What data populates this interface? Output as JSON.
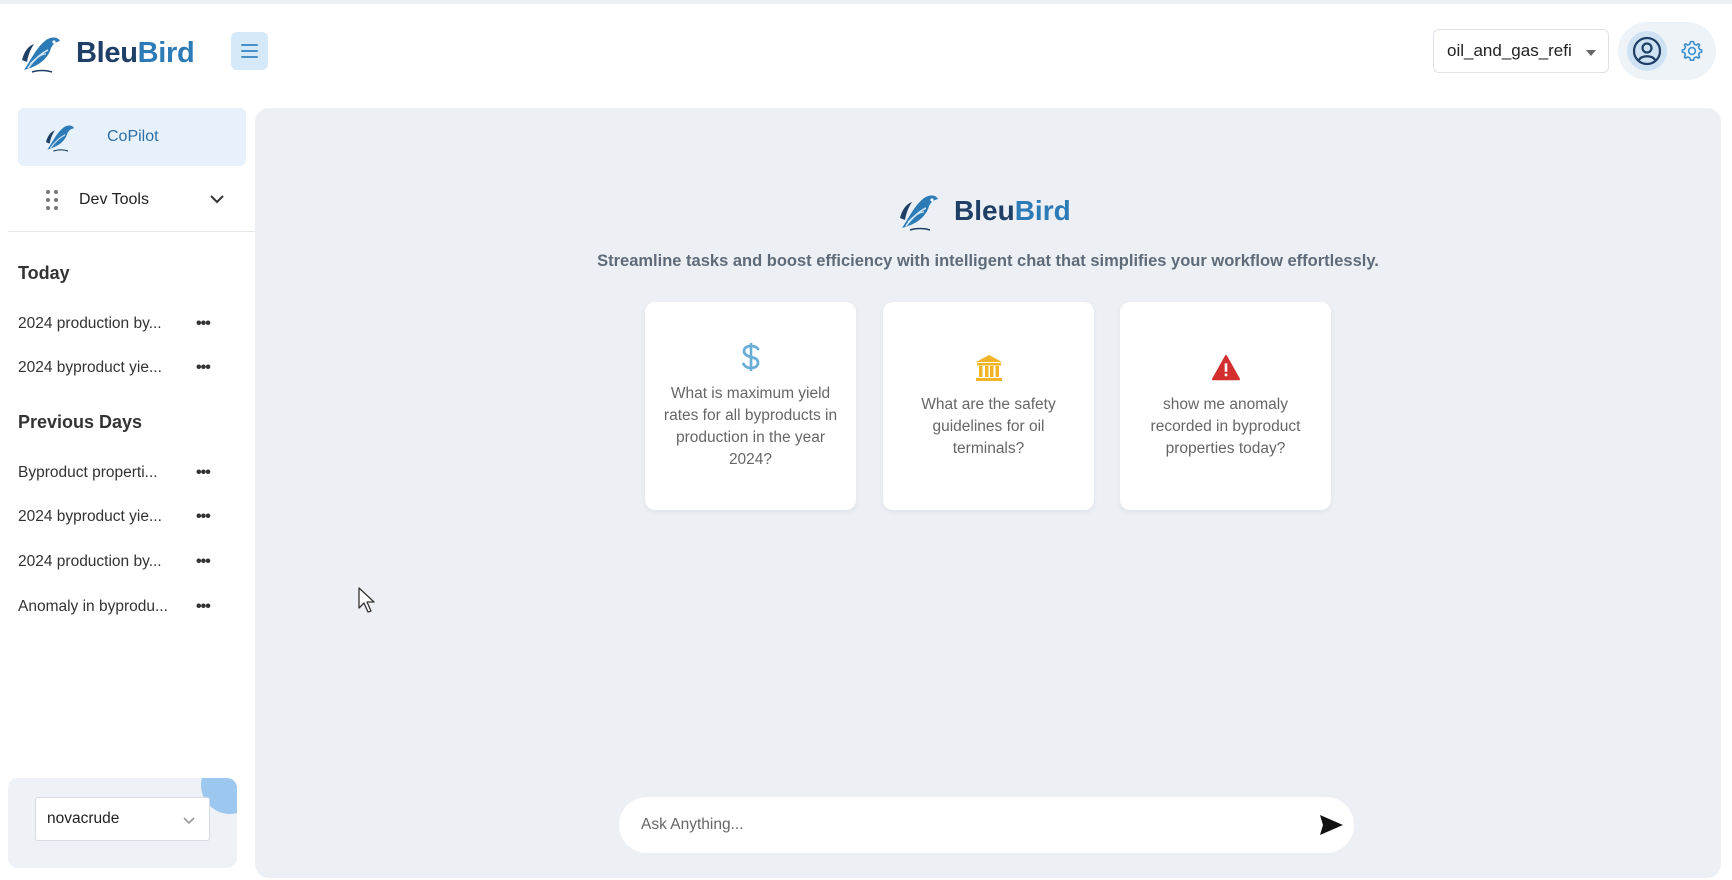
{
  "header": {
    "brand_part1": "Bleu",
    "brand_part2": "Bird",
    "database_select": {
      "value": "oil_and_gas_refi"
    }
  },
  "sidebar": {
    "copilot_label": "CoPilot",
    "devtools_label": "Dev Tools",
    "today_title": "Today",
    "today_items": [
      "2024 production by...",
      "2024 byproduct yie..."
    ],
    "previous_title": "Previous Days",
    "previous_items": [
      "Byproduct properti...",
      "2024 byproduct yie...",
      "2024 production by...",
      "Anomaly in byprodu..."
    ],
    "more_glyph": "•••",
    "tenant_select": {
      "value": "novacrude"
    }
  },
  "main": {
    "brand_part1": "Bleu",
    "brand_part2": "Bird",
    "tagline": "Streamline tasks and boost efficiency with intelligent chat that simplifies your workflow effortlessly.",
    "cards": [
      {
        "icon": "dollar-icon",
        "text": "What is maximum yield rates for all byproducts in production in the year 2024?"
      },
      {
        "icon": "bank-icon",
        "text": "What are the safety guidelines for oil terminals?"
      },
      {
        "icon": "warning-icon",
        "text": "show me anomaly recorded in byproduct properties today?"
      }
    ],
    "ask_placeholder": "Ask Anything..."
  },
  "colors": {
    "brand_dark": "#1f3f66",
    "brand_light": "#2d7bb6",
    "accent_bg": "#e6f1fb",
    "main_bg": "#ecf0f4",
    "bank_gold": "#f0b323",
    "warning_red": "#d32f2f"
  }
}
